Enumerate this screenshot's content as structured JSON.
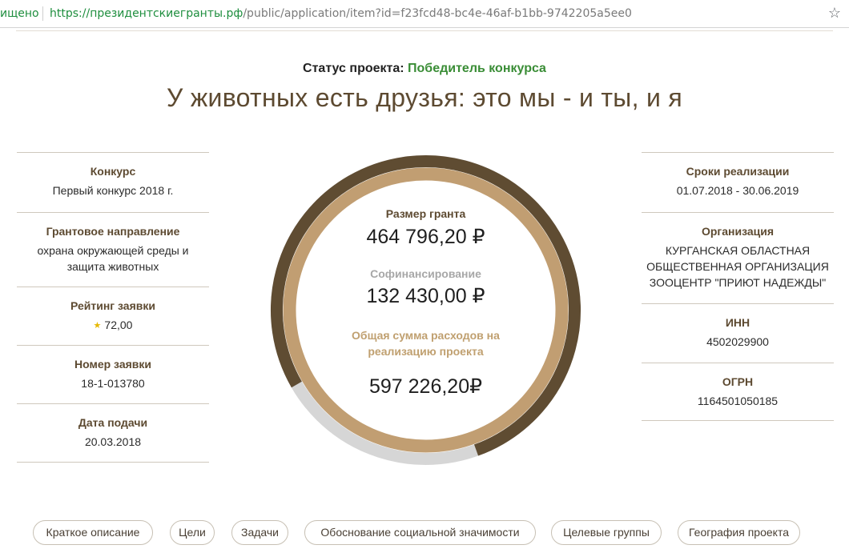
{
  "browser": {
    "secure_label": "ищено",
    "url_scheme": "https://",
    "url_host": "президентскиегранты.рф",
    "url_path": "/public/application/item?id=f23fcd48-bc4e-46af-b1bb-9742205a5ee0",
    "bookmark_icon": "star-icon"
  },
  "header": {
    "status_label": "Статус проекта:",
    "status_value": "Победитель конкурса",
    "title": "У животных есть друзья: это мы - и ты, и я"
  },
  "left_column": {
    "contest_label": "Конкурс",
    "contest_value": "Первый конкурс 2018 г.",
    "direction_label": "Грантовое направление",
    "direction_value": "охрана окружающей среды и защита животных",
    "rating_label": "Рейтинг заявки",
    "rating_value": "72,00",
    "number_label": "Номер заявки",
    "number_value": "18-1-013780",
    "date_label": "Дата подачи",
    "date_value": "20.03.2018"
  },
  "right_column": {
    "period_label": "Сроки реализации",
    "period_value": "01.07.2018 - 30.06.2019",
    "org_label": "Организация",
    "org_value": "КУРГАНСКАЯ ОБЛАСТНАЯ ОБЩЕСТВЕННАЯ ОРГАНИЗАЦИЯ ЗООЦЕНТР \"ПРИЮТ НАДЕЖДЫ\"",
    "inn_label": "ИНН",
    "inn_value": "4502029900",
    "ogrn_label": "ОГРН",
    "ogrn_value": "1164501050185"
  },
  "finance": {
    "grant_label": "Размер гранта",
    "grant_value": "464 796,20 ₽",
    "cofin_label": "Софинансирование",
    "cofin_value": "132 430,00 ₽",
    "total_label": "Общая сумма расходов на реализацию проекта",
    "total_value": "597 226,20₽",
    "grant_share": 0.778,
    "colors": {
      "grant": "#5f4c32",
      "cofin": "#d6d6d6",
      "inner": "#c19e72"
    }
  },
  "tabs": [
    "Краткое описание",
    "Цели",
    "Задачи",
    "Обоснование социальной значимости",
    "Целевые группы",
    "География проекта"
  ]
}
